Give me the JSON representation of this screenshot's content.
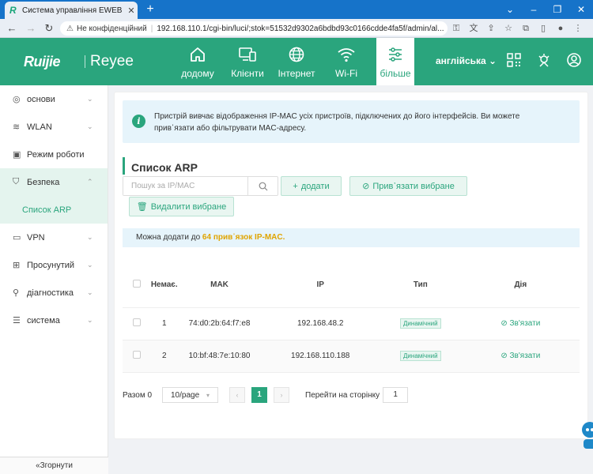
{
  "browser": {
    "tab_title": "Система управління EWEB",
    "tab_logo": "R",
    "new_tab": "+",
    "not_secure": "Не конфіденційний",
    "url": "192.168.110.1/cgi-bin/luci/;stok=51532d9302a6bdbd93c0166cdde4fa5f/admin/al..."
  },
  "header": {
    "logo_left": "Ruijie",
    "logo_right": "Reyee",
    "nav": [
      {
        "label": "додому",
        "icon": "home-icon"
      },
      {
        "label": "Клієнти",
        "icon": "devices-icon"
      },
      {
        "label": "Інтернет",
        "icon": "globe-icon"
      },
      {
        "label": "Wi-Fi",
        "icon": "wifi-icon"
      },
      {
        "label": "більше",
        "icon": "sliders-icon"
      }
    ],
    "language": "англійська"
  },
  "sidebar": {
    "items": [
      {
        "label": "основи",
        "icon": "globe-icon"
      },
      {
        "label": "WLAN",
        "icon": "wifi-icon"
      },
      {
        "label": "Режим роботи",
        "icon": "mode-icon"
      },
      {
        "label": "Безпека",
        "icon": "shield-icon"
      },
      {
        "label": "VPN",
        "icon": "vpn-icon"
      },
      {
        "label": "Просунутий",
        "icon": "advanced-icon"
      },
      {
        "label": "діагностика",
        "icon": "diagnostics-icon"
      },
      {
        "label": "система",
        "icon": "system-icon"
      }
    ],
    "sub_item": "Список ARP",
    "collapse": "«Згорнути"
  },
  "main": {
    "notice": "Пристрій вивчає відображення IP-MAC усіх пристроїв, підключених до його інтерфейсів. Ви можете прив᾽язати або фільтрувати MAC-адресу.",
    "title": "Список ARP",
    "search_placeholder": "Пошук за IP/MAC",
    "add_btn": "додати",
    "bind_selected_btn": "Прив᾽язати вибране",
    "delete_selected_btn": "Видалити вибране",
    "info_prefix": "Можна додати до",
    "info_highlight": "64 прив᾽язок IP-MAC.",
    "table": {
      "headers": [
        "Немає.",
        "MAK",
        "IP",
        "Тип",
        "Дія"
      ],
      "rows": [
        {
          "no": "1",
          "mac": "74:d0:2b:64:f7:e8",
          "ip": "192.168.48.2",
          "type": "Динамічний",
          "action": "Зв'язати"
        },
        {
          "no": "2",
          "mac": "10:bf:48:7e:10:80",
          "ip": "192.168.110.188",
          "type": "Динамічний",
          "action": "Зв'язати"
        }
      ]
    },
    "pager": {
      "total": "Разом 0",
      "page_size": "10/page",
      "current": "1",
      "goto_label": "Перейти на сторінку",
      "goto_value": "1"
    }
  },
  "colors": {
    "brand": "#2aa57d",
    "browser": "#1673c9",
    "highlight": "#e0a400"
  }
}
